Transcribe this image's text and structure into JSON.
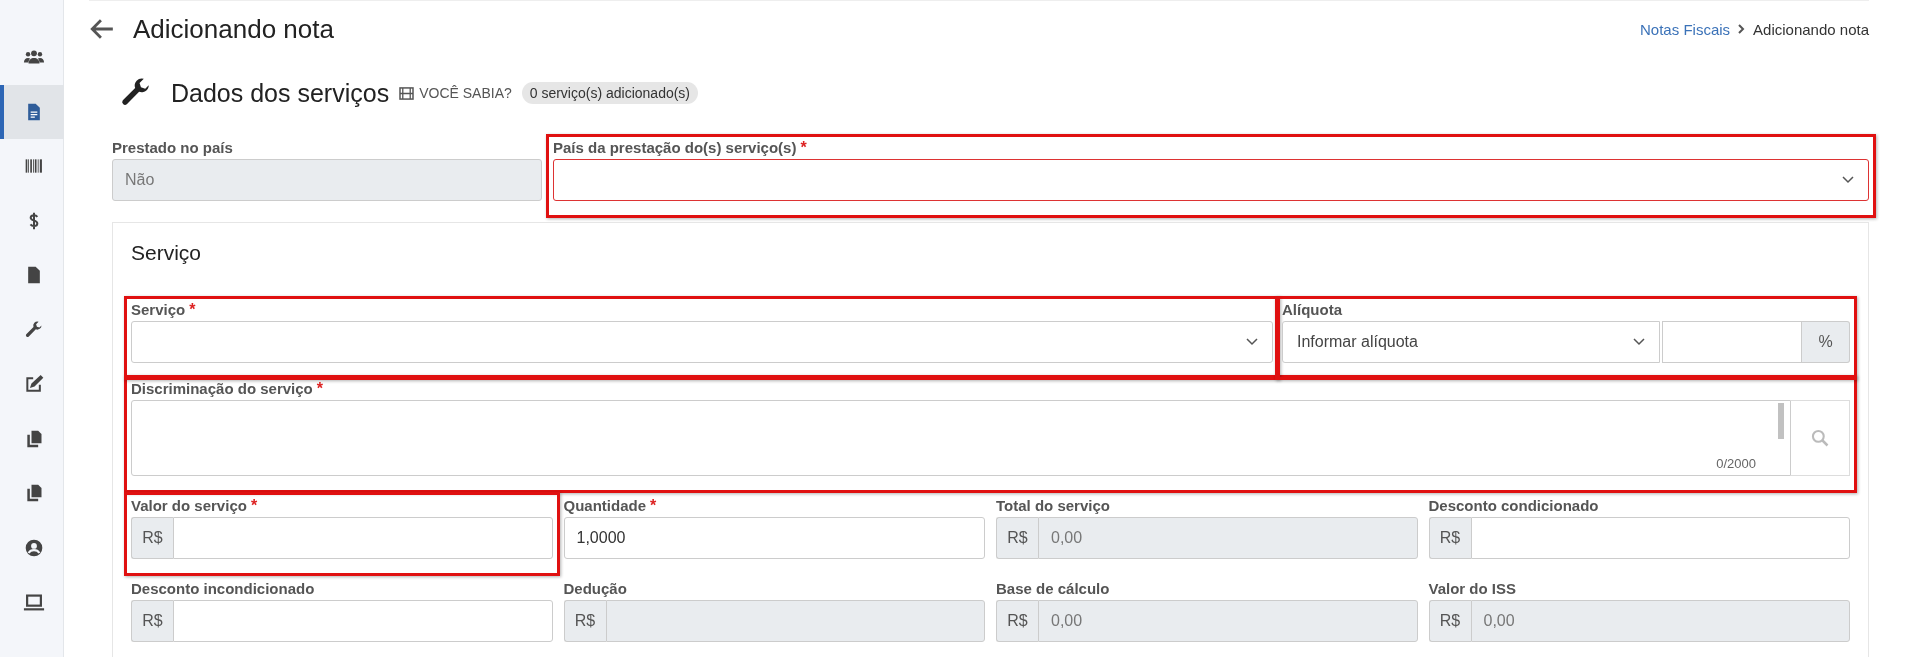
{
  "sidebar": {
    "items": [
      {
        "kind": "users",
        "selected": false
      },
      {
        "kind": "document",
        "selected": true
      },
      {
        "kind": "barcode",
        "selected": false
      },
      {
        "kind": "dollar",
        "selected": false
      },
      {
        "kind": "file",
        "selected": false
      },
      {
        "kind": "wrench",
        "selected": false
      },
      {
        "kind": "edit",
        "selected": false
      },
      {
        "kind": "copy",
        "selected": false
      },
      {
        "kind": "copy",
        "selected": false
      },
      {
        "kind": "user",
        "selected": false
      },
      {
        "kind": "laptop",
        "selected": false
      }
    ]
  },
  "header": {
    "title": "Adicionando nota",
    "breadcrumb": [
      {
        "label": "Notas Fiscais",
        "link": true
      },
      {
        "label": "Adicionando nota",
        "link": false
      }
    ]
  },
  "section": {
    "title": "Dados dos serviços",
    "hint": "VOCÊ SABIA?",
    "badge": "0 serviço(s) adicionado(s)"
  },
  "top_fields": [
    {
      "kind": "text",
      "label": "Prestado no país",
      "highlighted": false,
      "value": "Não",
      "disabled": true
    },
    {
      "kind": "select",
      "label": "País da prestação do(s) serviço(s)",
      "required_mark": "*",
      "highlighted": true,
      "invalid": true
    }
  ],
  "card": {
    "title": "Serviço",
    "service": {
      "kind": "select",
      "label": "Serviço",
      "required_mark": "*",
      "highlighted": true
    },
    "rate": {
      "label": "Alíquota",
      "highlighted": true,
      "select_value": "Informar alíquota",
      "suffix": "%"
    },
    "description": {
      "label": "Discriminação do serviço",
      "required_mark": "*",
      "highlighted": true,
      "counter": "0/2000"
    },
    "rows": [
      [
        {
          "kind": "currency",
          "label": "Valor do serviço",
          "required_mark": "*",
          "highlighted": true,
          "prefix": "R$",
          "disabled": false
        },
        {
          "kind": "text",
          "label": "Quantidade",
          "required_mark": "*",
          "highlighted": false,
          "value": "1,0000",
          "disabled": false
        },
        {
          "kind": "currency",
          "label": "Total do serviço",
          "highlighted": false,
          "prefix": "R$",
          "value": "0,00",
          "disabled": true
        },
        {
          "kind": "currency",
          "label": "Desconto condicionado",
          "highlighted": false,
          "prefix": "R$",
          "disabled": false
        }
      ],
      [
        {
          "kind": "currency",
          "label": "Desconto incondicionado",
          "highlighted": false,
          "prefix": "R$",
          "disabled": false
        },
        {
          "kind": "currency",
          "label": "Dedução",
          "highlighted": false,
          "prefix": "R$",
          "disabled": true
        },
        {
          "kind": "currency",
          "label": "Base de cálculo",
          "highlighted": false,
          "prefix": "R$",
          "value": "0,00",
          "disabled": true
        },
        {
          "kind": "currency",
          "label": "Valor do ISS",
          "highlighted": false,
          "prefix": "R$",
          "value": "0,00",
          "disabled": true
        }
      ]
    ]
  }
}
